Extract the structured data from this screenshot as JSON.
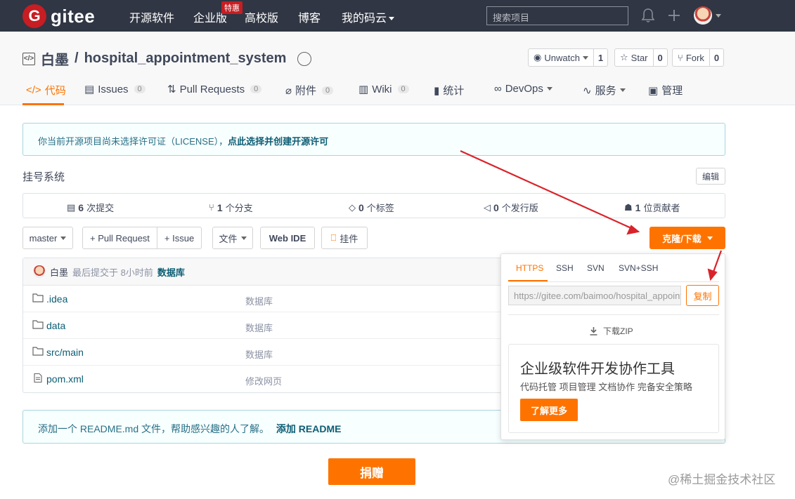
{
  "navbar": {
    "logo_letter": "G",
    "logo_text": "gitee",
    "links": [
      "开源软件",
      "企业版",
      "高校版",
      "博客",
      "我的码云"
    ],
    "badge": "特惠",
    "search_placeholder": "搜索项目"
  },
  "repo": {
    "owner": "白墨",
    "separator": "/",
    "name": "hospital_appointment_system",
    "actions": [
      {
        "label": "Unwatch",
        "count": "1"
      },
      {
        "label": "Star",
        "count": "0"
      },
      {
        "label": "Fork",
        "count": "0"
      }
    ],
    "tabs": [
      {
        "label": "代码",
        "badge": ""
      },
      {
        "label": "Issues",
        "badge": "0"
      },
      {
        "label": "Pull Requests",
        "badge": "0"
      },
      {
        "label": "附件",
        "badge": "0"
      },
      {
        "label": "Wiki",
        "badge": "0"
      },
      {
        "label": "统计",
        "badge": ""
      },
      {
        "label": "DevOps",
        "badge": ""
      },
      {
        "label": "服务",
        "badge": ""
      },
      {
        "label": "管理",
        "badge": ""
      }
    ]
  },
  "license_notice": {
    "text": "你当前开源项目尚未选择许可证（LICENSE），",
    "link": "点此选择并创建开源许可"
  },
  "description": "挂号系统",
  "edit_label": "编辑",
  "stats": [
    {
      "num": "6",
      "label": "次提交"
    },
    {
      "num": "1",
      "label": "个分支"
    },
    {
      "num": "0",
      "label": "个标签"
    },
    {
      "num": "0",
      "label": "个发行版"
    },
    {
      "num": "1",
      "label": "位贡献者"
    }
  ],
  "toolbar": {
    "branch": "master",
    "pull_request": "+ Pull Request",
    "issue": "+ Issue",
    "file": "文件",
    "web_ide": "Web IDE",
    "widget": "挂件",
    "clone": "克隆/下载"
  },
  "commit": {
    "author": "白墨",
    "time": "最后提交于 8小时前",
    "message": "数据库"
  },
  "files": [
    {
      "name": ".idea",
      "commit": "数据库",
      "type": "folder"
    },
    {
      "name": "data",
      "commit": "数据库",
      "type": "folder"
    },
    {
      "name": "src/main",
      "commit": "数据库",
      "type": "folder"
    },
    {
      "name": "pom.xml",
      "commit": "修改网页",
      "type": "file"
    }
  ],
  "readme_notice": {
    "text": "添加一个 README.md 文件，帮助感兴趣的人了解。",
    "link": "添加 README"
  },
  "donate": "捐赠",
  "watermark": "@稀土掘金技术社区",
  "clone_dropdown": {
    "tabs": [
      "HTTPS",
      "SSH",
      "SVN",
      "SVN+SSH"
    ],
    "url": "https://gitee.com/baimoo/hospital_appointment_system.git",
    "copy": "复制",
    "zip": "下载ZIP",
    "promo_title": "企业级软件开发协作工具",
    "promo_sub": "代码托管 项目管理 文档协作 完备安全策略",
    "promo_button": "了解更多"
  },
  "colors": {
    "accent": "#fe7300",
    "navbar": "#303643",
    "brand": "#c71d23",
    "link": "#0c5d74"
  }
}
